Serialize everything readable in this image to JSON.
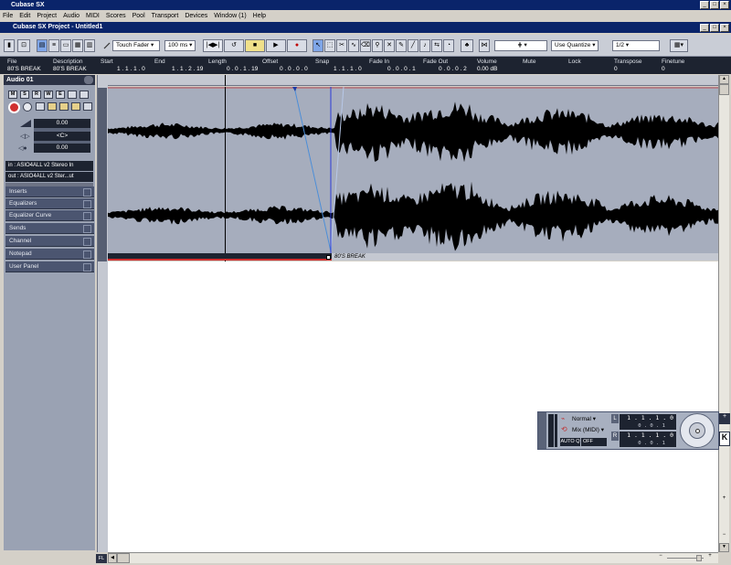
{
  "app": {
    "title": "Cubase SX",
    "project_title": "Cubase SX Project - Untitled1",
    "window_controls": [
      "_",
      "□",
      "×"
    ]
  },
  "menu": [
    "File",
    "Edit",
    "Project",
    "Audio",
    "MIDI",
    "Scores",
    "Pool",
    "Transport",
    "Devices",
    "Window (1)",
    "Help"
  ],
  "toolbar": {
    "automation_mode": "Touch Fader",
    "nudge": "100 ms",
    "use_quantize": "Use Quantize",
    "quantize_value": "1/2"
  },
  "infoline": {
    "headers": [
      "File",
      "Description",
      "Start",
      "End",
      "Length",
      "Offset",
      "Snap",
      "Fade In",
      "Fade Out",
      "Volume",
      "Mute",
      "Lock",
      "Transpose",
      "Finetune"
    ],
    "values": [
      "80'S BREAK",
      "80'S BREAK",
      "1 . 1 . 1 . 0",
      "1 . 1 . 2 . 19",
      "0 . 0 . 1 . 19",
      "0 . 0 . 0 . 0",
      "1 . 1 . 1 . 0",
      "0 . 0 . 0 . 1",
      "0 . 0 . 0 . 2",
      "0.00 dB",
      "",
      "",
      "0",
      "0"
    ]
  },
  "inspector": {
    "track_name": "Audio 01",
    "buttons": [
      "M",
      "S",
      "R",
      "W",
      "E"
    ],
    "volume": "0.00",
    "pan": "<C>",
    "delay": "0.00",
    "input": "in : ASIO4ALL v2 Stereo In",
    "output": "out : ASIO4ALL v2 Ster...ut",
    "sections": [
      "Inserts",
      "Equalizers",
      "Equalizer Curve",
      "Sends",
      "Channel",
      "Notepad",
      "User Panel"
    ]
  },
  "event": {
    "name": "80'S BREAK"
  },
  "transport": {
    "mode": "Normal",
    "mix": "Mix (MIDI)",
    "autoq": "AUTO Q",
    "off": "OFF",
    "left_locator": "1 . 1 . 1 . 0",
    "right_locator": "1 . 1 . 1 . 0",
    "left_sub": "0 . 0 . 1",
    "right_sub": "0 . 0 . 1",
    "L": "L",
    "R": "R"
  },
  "corner_label": "FL",
  "colors": {
    "titlebar": "#0a246a",
    "waveform_bg": "#a6adbd",
    "waveform": "#000000",
    "cursor_line": "#2a3bd6"
  }
}
